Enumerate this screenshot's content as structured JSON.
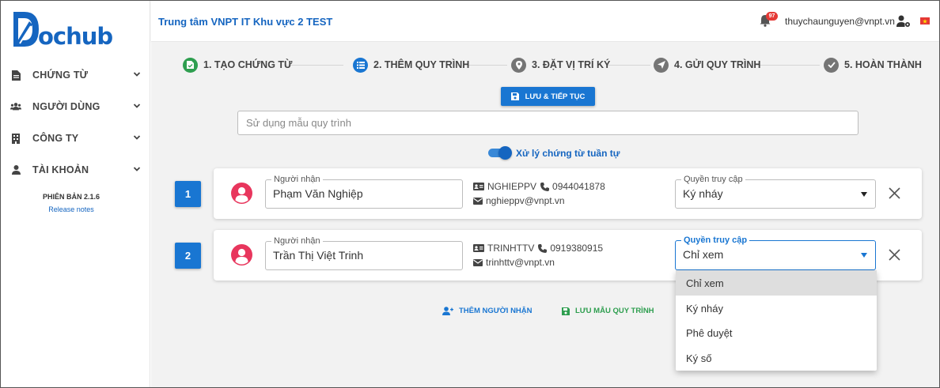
{
  "app": {
    "logo_text": "ochub",
    "header_title": "Trung tâm VNPT IT Khu vực 2 TEST",
    "notification_count": "97",
    "user_email": "thuychaunguyen@vnpt.vn"
  },
  "sidebar": {
    "items": [
      {
        "label": "CHỨNG TỪ",
        "icon": "document-icon"
      },
      {
        "label": "NGƯỜI DÙNG",
        "icon": "users-icon"
      },
      {
        "label": "CÔNG TY",
        "icon": "building-icon"
      },
      {
        "label": "TÀI KHOẢN",
        "icon": "user-icon"
      }
    ],
    "version": "PHIÊN BẢN 2.1.6",
    "release_notes": "Release notes"
  },
  "stepper": {
    "steps": [
      {
        "label": "1. TẠO CHỨNG TỪ",
        "status": "done",
        "color": "#2e9e4f"
      },
      {
        "label": "2. THÊM QUY TRÌNH",
        "status": "active",
        "color": "#1976d2"
      },
      {
        "label": "3. ĐẶT VỊ TRÍ KÝ",
        "status": "pending",
        "color": "#757575"
      },
      {
        "label": "4. GỬI QUY TRÌNH",
        "status": "pending",
        "color": "#757575"
      },
      {
        "label": "5. HOÀN THÀNH",
        "status": "pending",
        "color": "#757575"
      }
    ]
  },
  "form": {
    "save_continue": "LƯU & TIẾP TỤC",
    "template_placeholder": "Sử dụng mẫu quy trình",
    "sequential_label": "Xử lý chứng từ tuần tự",
    "sequential_on": true
  },
  "recipients": [
    {
      "number": "1",
      "legend": "Người nhận",
      "name": "Phạm Văn Nghiệp",
      "username": "NGHIEPPV",
      "phone": "0944041878",
      "email": "nghieppv@vnpt.vn",
      "access_legend": "Quyền truy cập",
      "access": "Ký nháy"
    },
    {
      "number": "2",
      "legend": "Người nhận",
      "name": "Trần Thị Việt Trinh",
      "username": "TRINHTTV",
      "phone": "0919380915",
      "email": "trinhttv@vnpt.vn",
      "access_legend": "Quyền truy cập",
      "access": "Chỉ xem"
    }
  ],
  "dropdown": {
    "options": [
      "Chỉ xem",
      "Ký nháy",
      "Phê duyệt",
      "Ký số"
    ],
    "selected": "Chỉ xem"
  },
  "actions": {
    "add_recipient": "THÊM NGƯỜI NHẬN",
    "save_template": "LƯU MẪU QUY TRÌNH"
  },
  "colors": {
    "primary": "#1976d2",
    "success": "#2e9e4f",
    "avatar": "#e8365d",
    "badge": "#e53935"
  }
}
